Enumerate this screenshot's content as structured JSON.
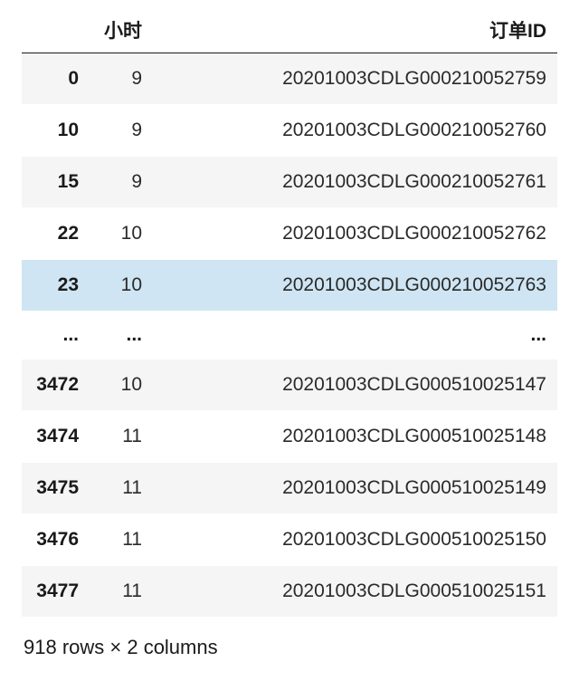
{
  "table": {
    "headers": {
      "index": "",
      "hour": "小时",
      "order_id": "订单ID"
    },
    "rows": [
      {
        "index": "0",
        "hour": "9",
        "order_id": "20201003CDLG000210052759",
        "class": "even"
      },
      {
        "index": "10",
        "hour": "9",
        "order_id": "20201003CDLG000210052760",
        "class": "odd"
      },
      {
        "index": "15",
        "hour": "9",
        "order_id": "20201003CDLG000210052761",
        "class": "even"
      },
      {
        "index": "22",
        "hour": "10",
        "order_id": "20201003CDLG000210052762",
        "class": "odd"
      },
      {
        "index": "23",
        "hour": "10",
        "order_id": "20201003CDLG000210052763",
        "class": "highlight"
      },
      {
        "index": "...",
        "hour": "...",
        "order_id": "...",
        "class": "ellipsis odd"
      },
      {
        "index": "3472",
        "hour": "10",
        "order_id": "20201003CDLG000510025147",
        "class": "even"
      },
      {
        "index": "3474",
        "hour": "11",
        "order_id": "20201003CDLG000510025148",
        "class": "odd"
      },
      {
        "index": "3475",
        "hour": "11",
        "order_id": "20201003CDLG000510025149",
        "class": "even"
      },
      {
        "index": "3476",
        "hour": "11",
        "order_id": "20201003CDLG000510025150",
        "class": "odd"
      },
      {
        "index": "3477",
        "hour": "11",
        "order_id": "20201003CDLG000510025151",
        "class": "even"
      }
    ]
  },
  "summary": "918 rows × 2 columns"
}
